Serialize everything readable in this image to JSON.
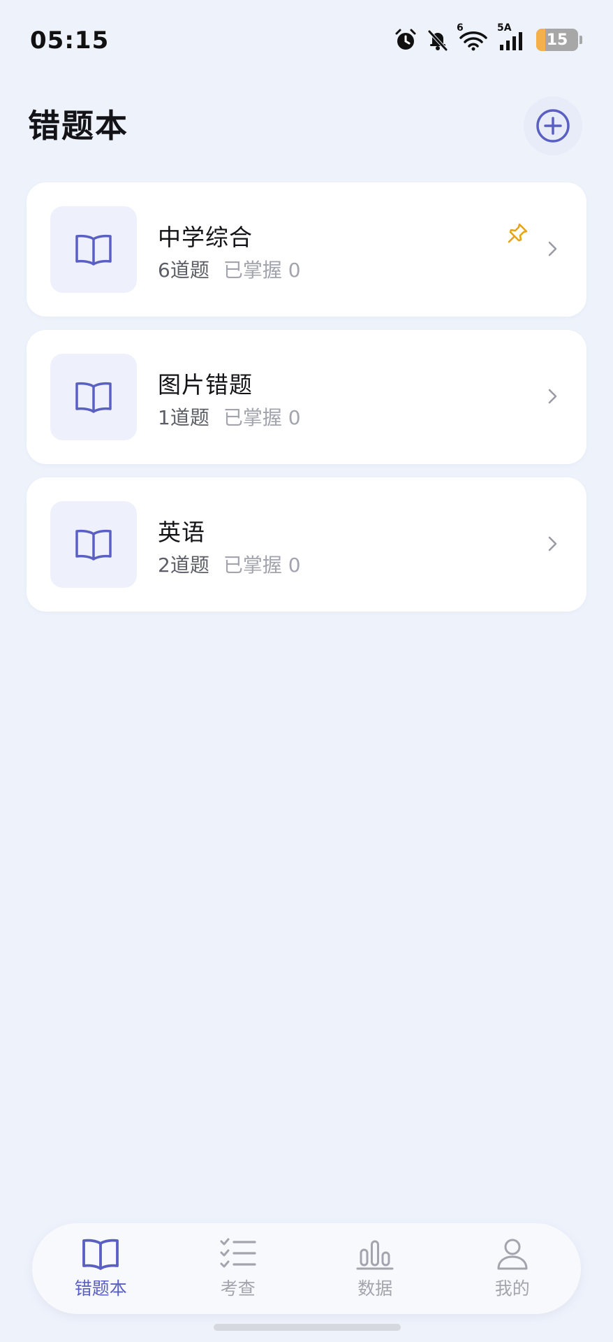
{
  "status_bar": {
    "time": "05:15",
    "battery_level": "15",
    "wifi_label": "6",
    "signal_label": "5A"
  },
  "header": {
    "title": "错题本"
  },
  "notebooks": [
    {
      "title": "中学综合",
      "count": "6道题",
      "mastered": "已掌握 0",
      "pinned": true
    },
    {
      "title": "图片错题",
      "count": "1道题",
      "mastered": "已掌握 0",
      "pinned": false
    },
    {
      "title": "英语",
      "count": "2道题",
      "mastered": "已掌握 0",
      "pinned": false
    }
  ],
  "bottom_nav": {
    "items": [
      {
        "label": "错题本",
        "icon": "book-icon",
        "active": true
      },
      {
        "label": "考查",
        "icon": "checklist-icon",
        "active": false
      },
      {
        "label": "数据",
        "icon": "bar-chart-icon",
        "active": false
      },
      {
        "label": "我的",
        "icon": "person-icon",
        "active": false
      }
    ]
  },
  "colors": {
    "accent": "#5a5fc2",
    "background": "#eef2fb",
    "pin": "#e8a21b",
    "battery": "#f4b04b"
  }
}
